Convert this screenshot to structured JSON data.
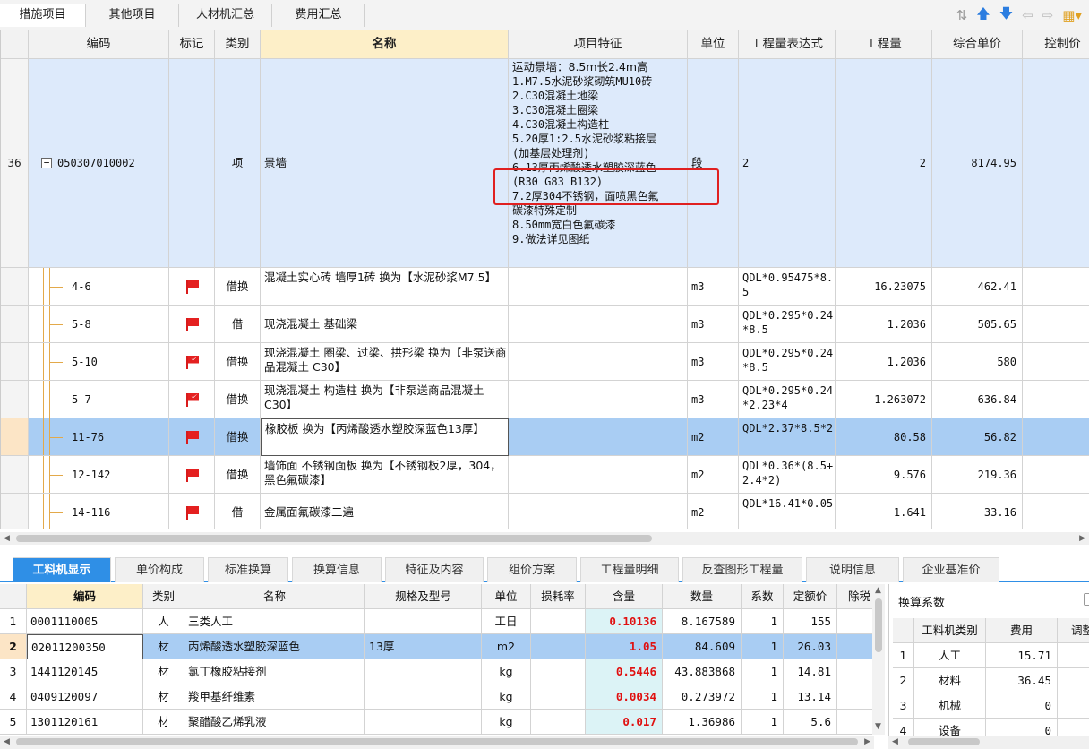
{
  "top_tabs": [
    "措施项目",
    "其他项目",
    "人材机汇总",
    "费用汇总"
  ],
  "headers": {
    "code": "编码",
    "mark": "标记",
    "type": "类别",
    "name": "名称",
    "feature": "项目特征",
    "unit": "单位",
    "expr": "工程量表达式",
    "qty": "工程量",
    "price": "综合单价",
    "ctrl": "控制价"
  },
  "item36": {
    "rownum": "36",
    "code": "050307010002",
    "type": "项",
    "name": "景墙",
    "unit": "段",
    "expr": "2",
    "qty": "2",
    "price": "8174.95",
    "features": [
      "运动景墙：8.5m长2.4m高",
      "1.M7.5水泥砂浆砌筑MU10砖",
      "2.C30混凝土地梁",
      "3.C30混凝土圈梁",
      "4.C30混凝土构造柱",
      "5.20厚1:2.5水泥砂浆粘接层",
      "(加基层处理剂)",
      "6.13厚丙烯酸透水塑胶深蓝色",
      "(R30 G83 B132)",
      "7.2厚304不锈钢，面喷黑色氟",
      "碳漆特殊定制",
      "8.50mm宽白色氟碳漆",
      "9.做法详见图纸"
    ]
  },
  "subitems": [
    {
      "code": "4-6",
      "type": "借换",
      "name": "混凝土实心砖 墙厚1砖  换为【水泥砂浆M7.5】",
      "unit": "m3",
      "expr": "QDL*0.95475*8.5",
      "qty": "16.23075",
      "price": "462.41"
    },
    {
      "code": "5-8",
      "type": "借",
      "name": "现浇混凝土 基础梁",
      "unit": "m3",
      "expr": "QDL*0.295*0.24*8.5",
      "qty": "1.2036",
      "price": "505.65"
    },
    {
      "code": "5-10",
      "type": "借换",
      "name": "现浇混凝土 圈梁、过梁、拱形梁  换为【非泵送商品混凝土 C30】",
      "unit": "m3",
      "expr": "QDL*0.295*0.24*8.5",
      "qty": "1.2036",
      "price": "580"
    },
    {
      "code": "5-7",
      "type": "借换",
      "name": "现浇混凝土 构造柱  换为【非泵送商品混凝土 C30】",
      "unit": "m3",
      "expr": "QDL*0.295*0.24*2.23*4",
      "qty": "1.263072",
      "price": "636.84"
    },
    {
      "code": "11-76",
      "type": "借换",
      "name": "橡胶板  换为【丙烯酸透水塑胶深蓝色13厚】",
      "unit": "m2",
      "expr": "QDL*2.37*8.5*2",
      "qty": "80.58",
      "price": "56.82"
    },
    {
      "code": "12-142",
      "type": "借换",
      "name": "墙饰面 不锈钢面板  换为【不锈钢板2厚，304，黑色氟碳漆】",
      "unit": "m2",
      "expr": "QDL*0.36*(8.5+2.4*2)",
      "qty": "9.576",
      "price": "219.36"
    },
    {
      "code": "14-116",
      "type": "借",
      "name": "金属面氟碳漆二遍",
      "unit": "m2",
      "expr": "QDL*16.41*0.05",
      "qty": "1.641",
      "price": "33.16"
    }
  ],
  "bottom_tabs": [
    "工料机显示",
    "单价构成",
    "标准换算",
    "换算信息",
    "特征及内容",
    "组价方案",
    "工程量明细",
    "反查图形工程量",
    "说明信息",
    "企业基准价"
  ],
  "bheaders": {
    "code": "编码",
    "type": "类别",
    "name": "名称",
    "spec": "规格及型号",
    "unit": "单位",
    "loss": "损耗率",
    "content": "含量",
    "count": "数量",
    "coef": "系数",
    "price": "定额价",
    "tax": "除税"
  },
  "brows": [
    {
      "n": "1",
      "code": "0001110005",
      "type": "人",
      "name": "三类人工",
      "spec": "",
      "unit": "工日",
      "content": "0.10136",
      "count": "8.167589",
      "coef": "1",
      "price": "155"
    },
    {
      "n": "2",
      "code": "02011200350",
      "type": "材",
      "name": "丙烯酸透水塑胶深蓝色",
      "spec": "13厚",
      "unit": "m2",
      "content": "1.05",
      "count": "84.609",
      "coef": "1",
      "price": "26.03"
    },
    {
      "n": "3",
      "code": "1441120145",
      "type": "材",
      "name": "氯丁橡胶粘接剂",
      "spec": "",
      "unit": "kg",
      "content": "0.5446",
      "count": "43.883868",
      "coef": "1",
      "price": "14.81"
    },
    {
      "n": "4",
      "code": "0409120097",
      "type": "材",
      "name": "羧甲基纤维素",
      "spec": "",
      "unit": "kg",
      "content": "0.0034",
      "count": "0.273972",
      "coef": "1",
      "price": "13.14"
    },
    {
      "n": "5",
      "code": "1301120161",
      "type": "材",
      "name": "聚醋酸乙烯乳液",
      "spec": "",
      "unit": "kg",
      "content": "0.017",
      "count": "1.36986",
      "coef": "1",
      "price": "5.6"
    }
  ],
  "right_panel": {
    "title": "换算系数",
    "headers": {
      "cat": "工料机类别",
      "fee": "费用",
      "adj": "调整"
    },
    "rows": [
      {
        "n": "1",
        "cat": "人工",
        "fee": "15.71"
      },
      {
        "n": "2",
        "cat": "材料",
        "fee": "36.45"
      },
      {
        "n": "3",
        "cat": "机械",
        "fee": "0"
      },
      {
        "n": "4",
        "cat": "设备",
        "fee": "0"
      }
    ]
  }
}
